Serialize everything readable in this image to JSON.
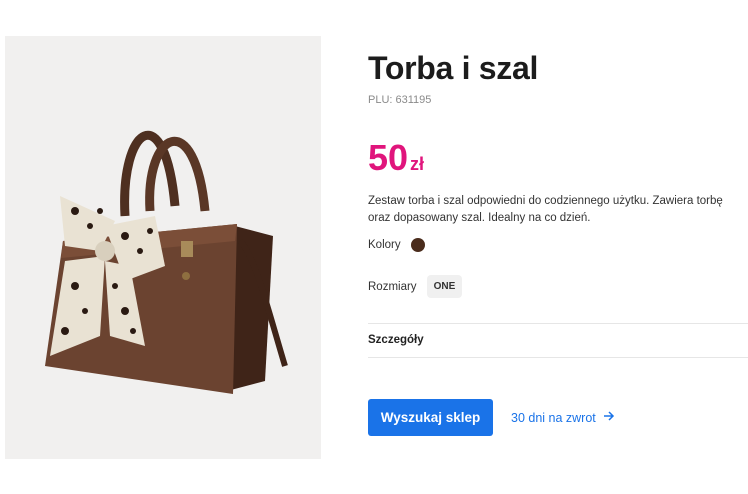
{
  "product": {
    "title": "Torba i szal",
    "plu": "PLU: 631195",
    "price_amount": "50",
    "price_currency": "zł",
    "description": "Zestaw torba i szal odpowiedni do codziennego użytku. Zawiera torbę oraz dopasowany szal. Idealny na co dzień.",
    "colors_label": "Kolory",
    "color_swatch": "#4a2c1c",
    "sizes_label": "Rozmiary",
    "size_option": "ONE",
    "details_label": "Szczegóły"
  },
  "actions": {
    "find_store_label": "Wyszukaj sklep",
    "return_label": "30 dni na zwrot"
  },
  "colors": {
    "accent_price": "#e0157c",
    "accent_button": "#1a73e8"
  }
}
